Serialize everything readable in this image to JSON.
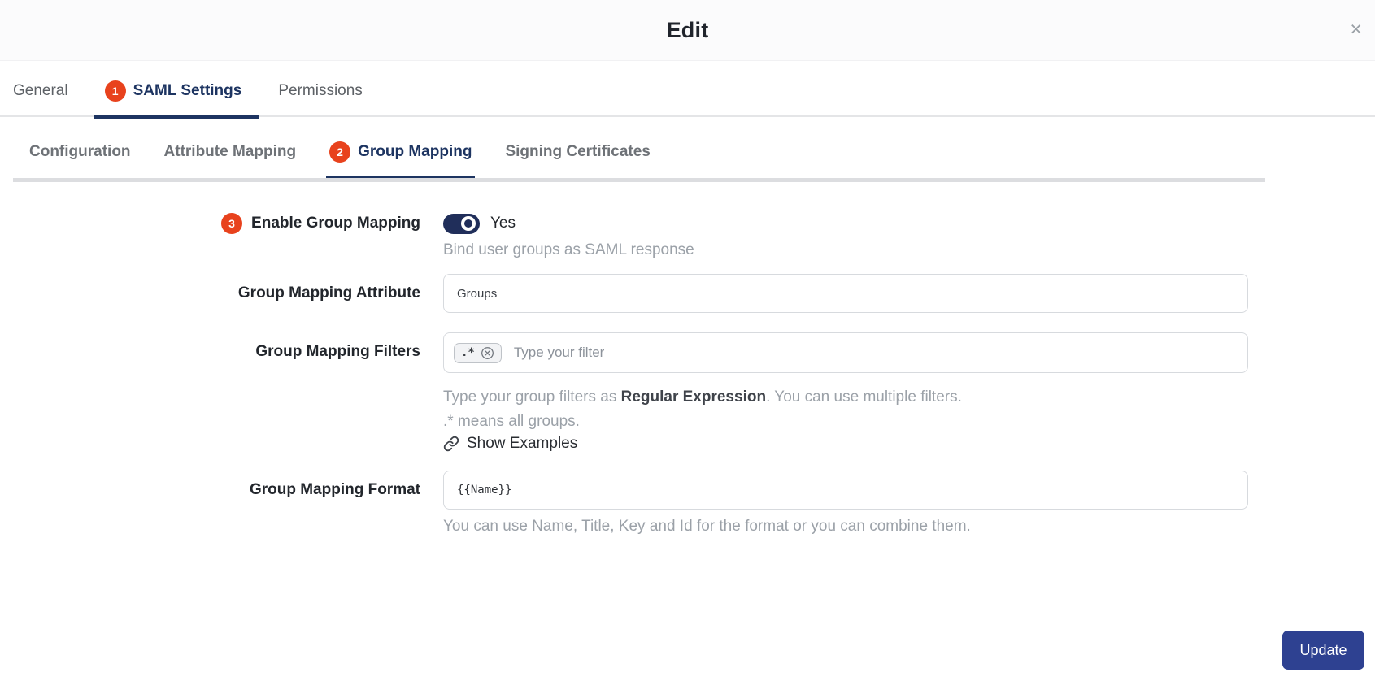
{
  "dialog": {
    "title": "Edit"
  },
  "icons": {
    "close": "×",
    "chip_remove": "circle-x-icon",
    "examples_link": "chain-link-icon"
  },
  "colors": {
    "accent_navy": "#1d3461",
    "toggle_navy": "#202e5a",
    "badge_red": "#e8421d",
    "button_indigo": "#2e4191"
  },
  "main_tabs": {
    "general": "General",
    "saml": "SAML Settings",
    "saml_badge": "1",
    "permissions": "Permissions"
  },
  "sub_tabs": {
    "configuration": "Configuration",
    "attribute_mapping": "Attribute Mapping",
    "group_badge": "2",
    "group_mapping": "Group Mapping",
    "signing_certificates": "Signing Certificates"
  },
  "form": {
    "enable_group_mapping": {
      "badge": "3",
      "label": "Enable Group Mapping",
      "toggle_state": "Yes",
      "help": "Bind user groups as SAML response"
    },
    "group_mapping_attribute": {
      "label": "Group Mapping Attribute",
      "value": "Groups"
    },
    "group_mapping_filters": {
      "label": "Group Mapping Filters",
      "chip": ".*",
      "placeholder": "Type your filter",
      "help_prefix": "Type your group filters as ",
      "help_bold": "Regular Expression",
      "help_suffix": ". You can use multiple filters.",
      "help_line2": ".* means all groups.",
      "examples_link": "Show Examples"
    },
    "group_mapping_format": {
      "label": "Group Mapping Format",
      "value": "{{Name}}",
      "help": "You can use Name, Title, Key and Id for the format or you can combine them."
    }
  },
  "footer": {
    "update_label": "Update"
  }
}
